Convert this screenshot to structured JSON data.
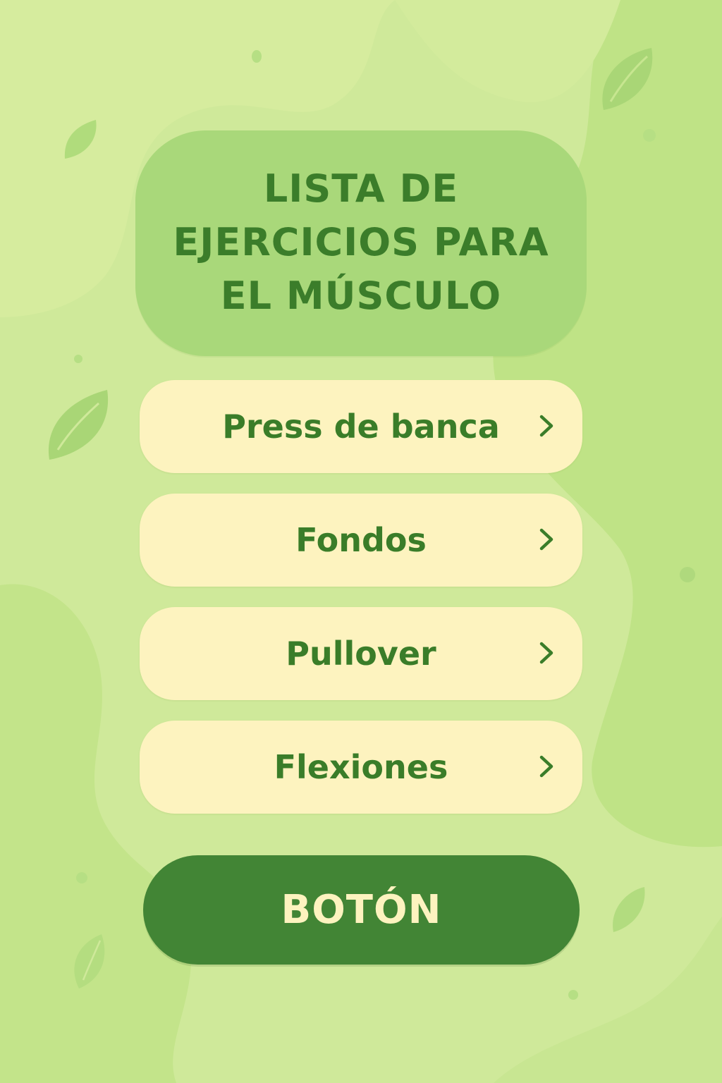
{
  "header": {
    "title_line1": "LISTA DE",
    "title_line2": "EJERCICIOS PARA",
    "title_line3": "EL MÚSCULO"
  },
  "exercises": [
    {
      "label": "Press de banca",
      "icon": "chevron-right-icon"
    },
    {
      "label": "Fondos",
      "icon": "chevron-right-icon"
    },
    {
      "label": "Pullover",
      "icon": "chevron-right-icon"
    },
    {
      "label": "Flexiones",
      "icon": "chevron-right-icon"
    }
  ],
  "action_button": {
    "label": "BOTÓN"
  },
  "colors": {
    "background": "#cfe99a",
    "title_card": "#a9d87a",
    "item_background": "#fdf3bf",
    "text_green": "#3a7d29",
    "button_green": "#428535",
    "button_text": "#fdf3bf"
  }
}
